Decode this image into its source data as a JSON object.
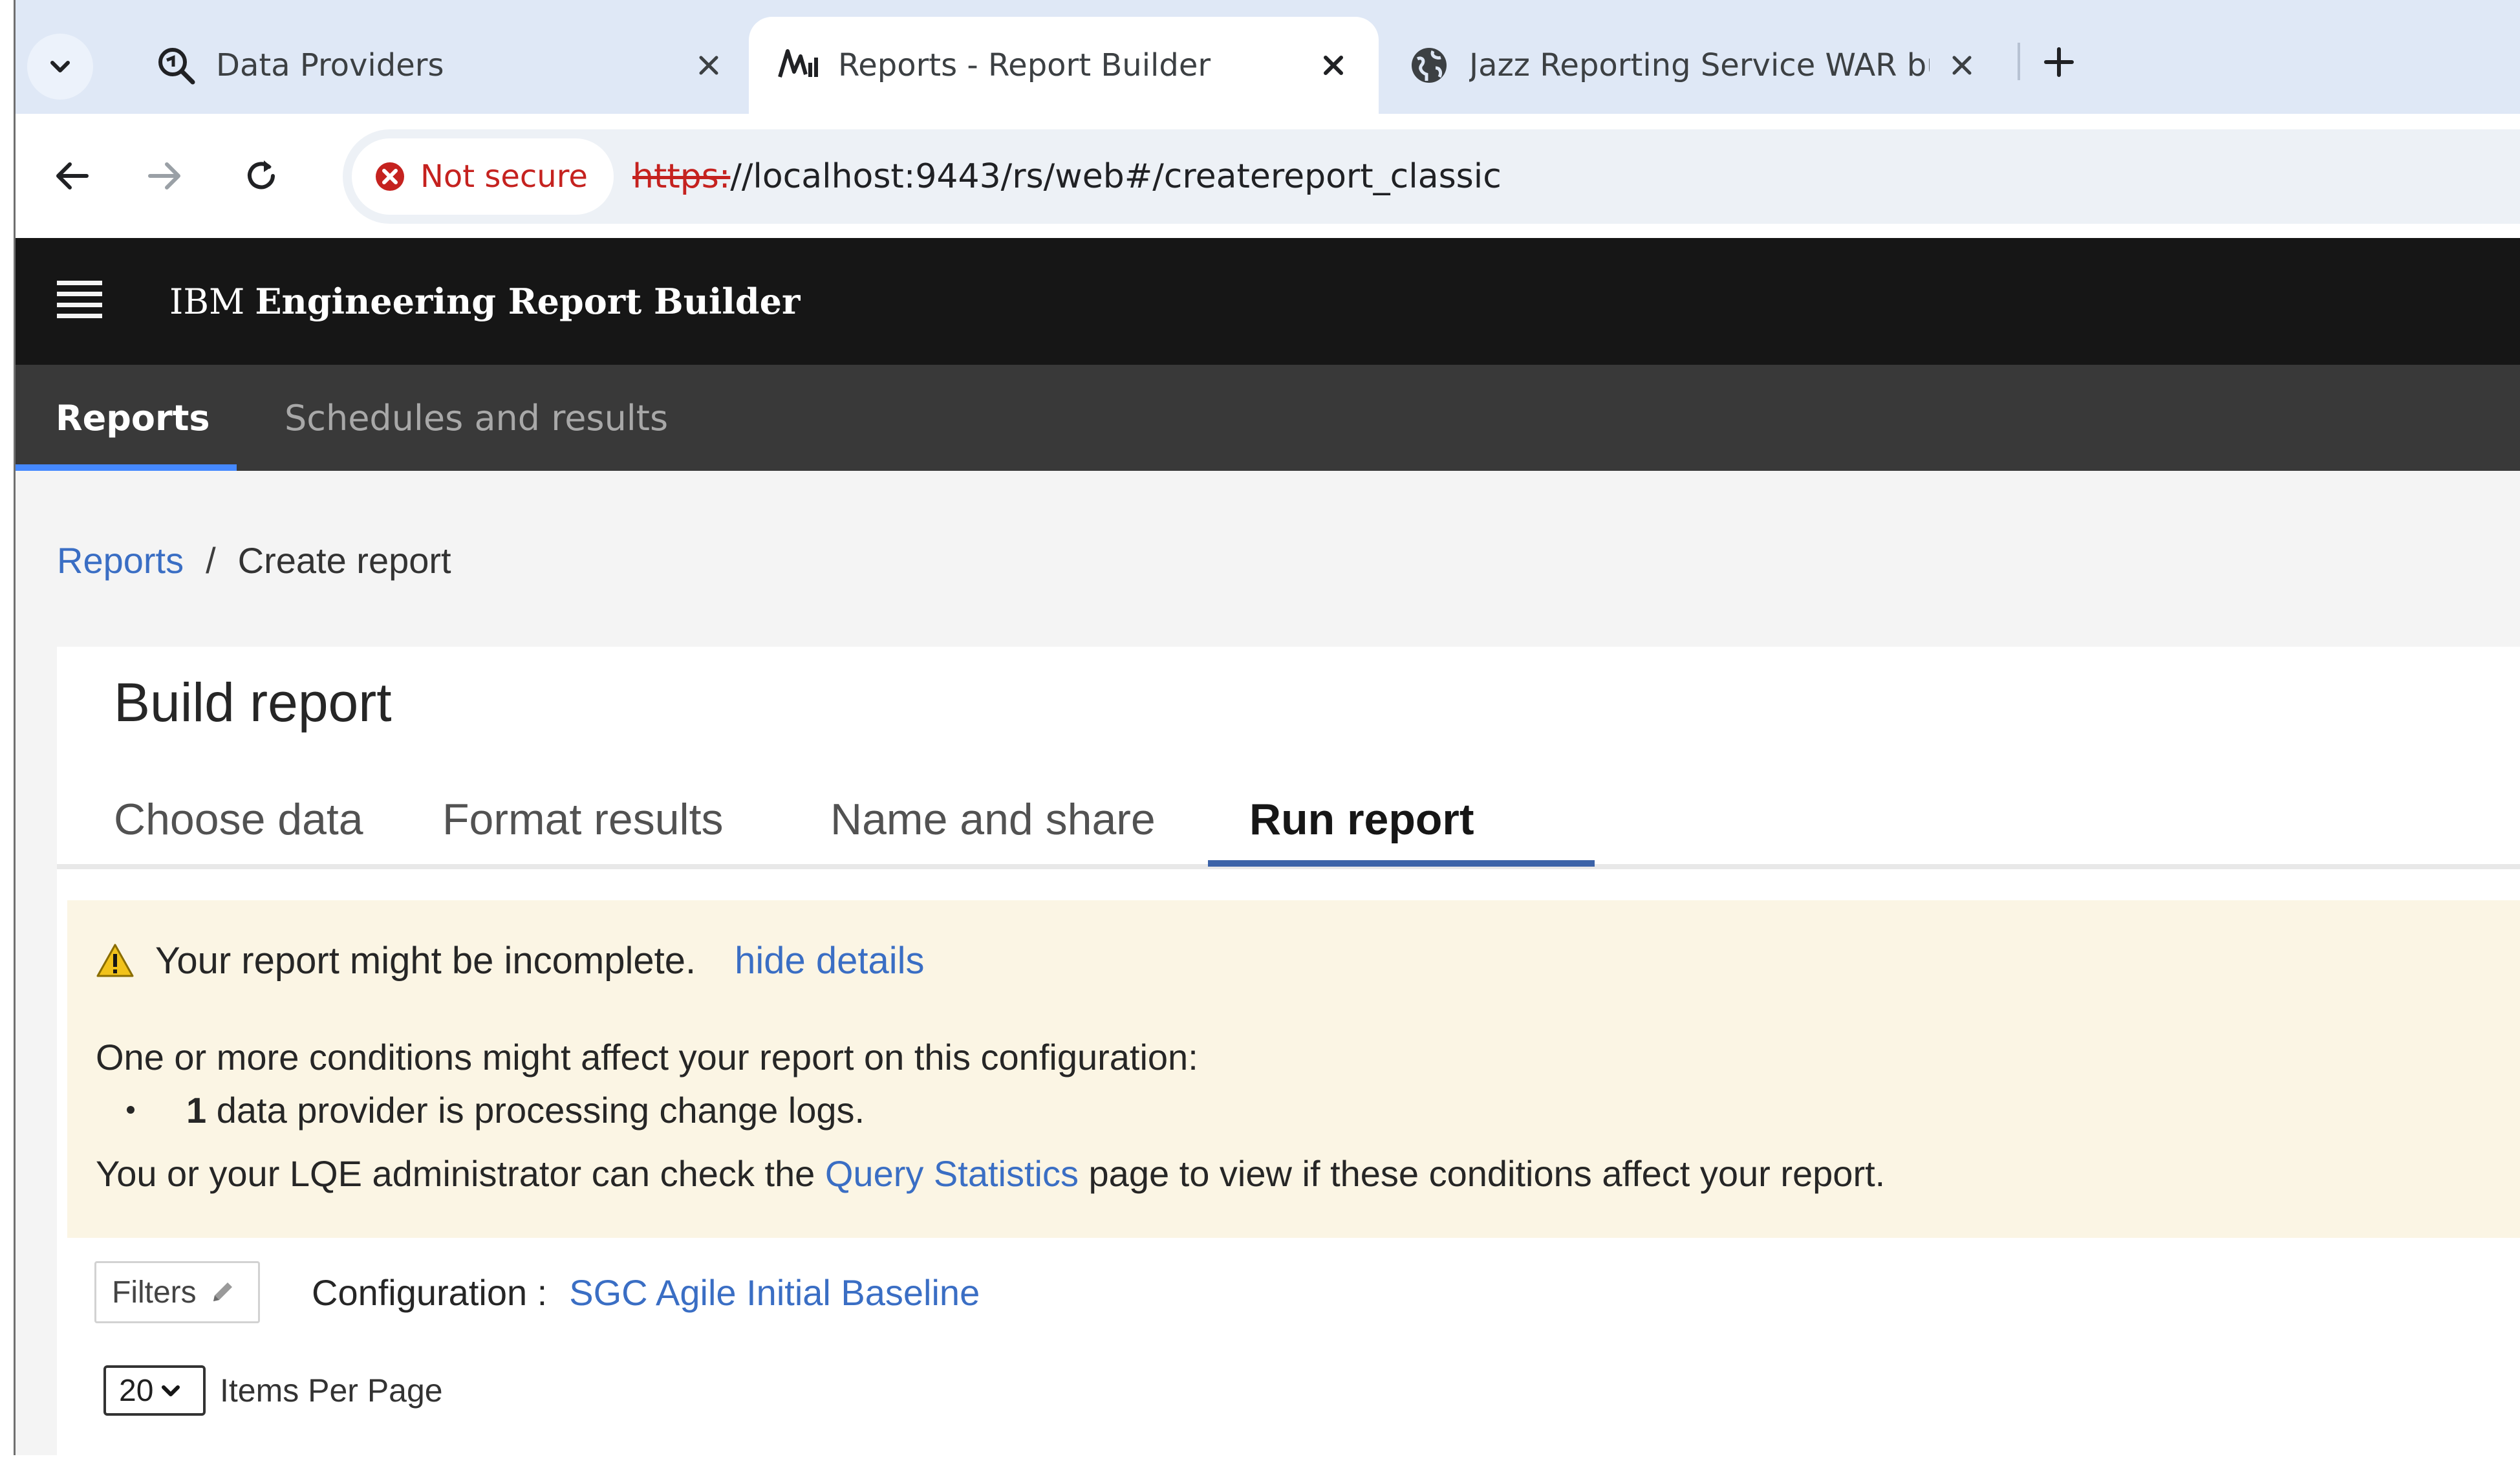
{
  "browser": {
    "tabs": [
      {
        "title": "Data Providers",
        "icon": "search-icon",
        "active": false
      },
      {
        "title": "Reports - Report Builder",
        "icon": "report-builder-icon",
        "active": true
      },
      {
        "title": "Jazz Reporting Service WAR bu",
        "icon": "globe-icon",
        "active": false
      }
    ],
    "security_label": "Not secure",
    "url_scheme": "https:",
    "url_rest": "//localhost:9443/rs/web#/createreport_classic"
  },
  "app": {
    "brand_prefix": "IBM",
    "brand_name": "Engineering Report Builder",
    "nav": {
      "reports": "Reports",
      "schedules": "Schedules and results"
    }
  },
  "breadcrumb": {
    "parent": "Reports",
    "separator": "/",
    "current": "Create report"
  },
  "build": {
    "title": "Build report",
    "tabs": [
      "Choose data",
      "Format results",
      "Name and share",
      "Run report"
    ],
    "active_tab": "Run report"
  },
  "warning": {
    "message": "Your report might be incomplete.",
    "hide_link": "hide details",
    "conditions_intro": "One or more conditions might affect your report on this configuration:",
    "bullet_count": "1",
    "bullet_text": "data provider is processing change logs.",
    "check_prefix": "You or your LQE administrator can check the",
    "check_link": "Query Statistics",
    "check_suffix": "page to view if these conditions affect your report."
  },
  "filters": {
    "button_label": "Filters",
    "configuration_label": "Configuration :",
    "configuration_value": "SGC Agile Initial Baseline"
  },
  "pagination": {
    "per_page_value": "20",
    "per_page_label": "Items Per Page"
  },
  "colors": {
    "header_bg": "#161616",
    "subnav_bg": "#393939",
    "link": "#3a6ec4",
    "warning_bg": "#fbf5e4",
    "active_tab_line": "#3c63a8"
  }
}
